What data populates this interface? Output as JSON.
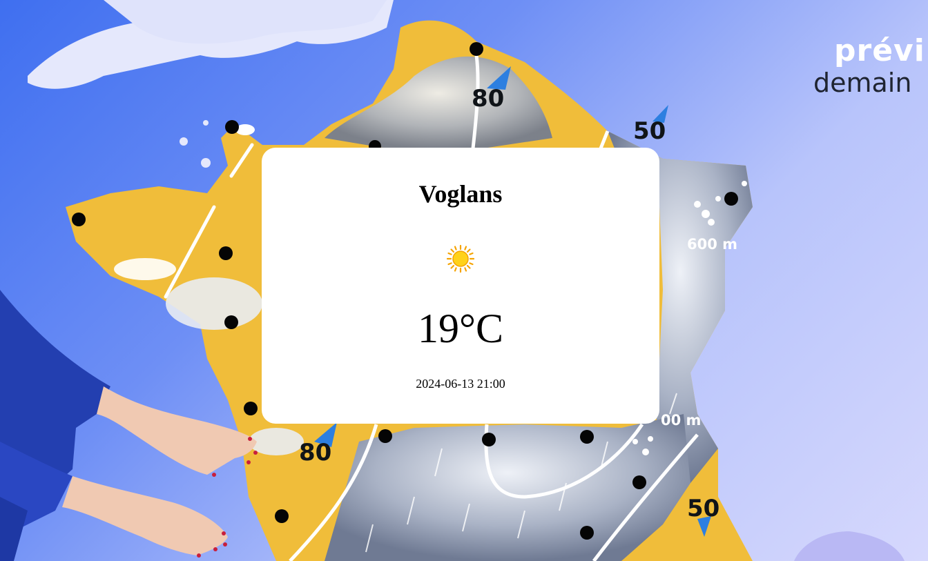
{
  "background": {
    "brand_line1": "prévi",
    "brand_line2": "demain",
    "wind_labels": [
      "80",
      "50",
      "80",
      "50"
    ],
    "altitude_labels": [
      "600 m",
      "00 m"
    ],
    "colors": {
      "sea": "#4a75f2",
      "land_sunny": "#f0bd3a",
      "land_cloudy": "#8c97ad",
      "presenter_sleeve": "#233fb0"
    }
  },
  "weather_card": {
    "city": "Voglans",
    "condition_icon": "sun-icon",
    "temperature": "19°C",
    "datetime": "2024-06-13 21:00"
  }
}
